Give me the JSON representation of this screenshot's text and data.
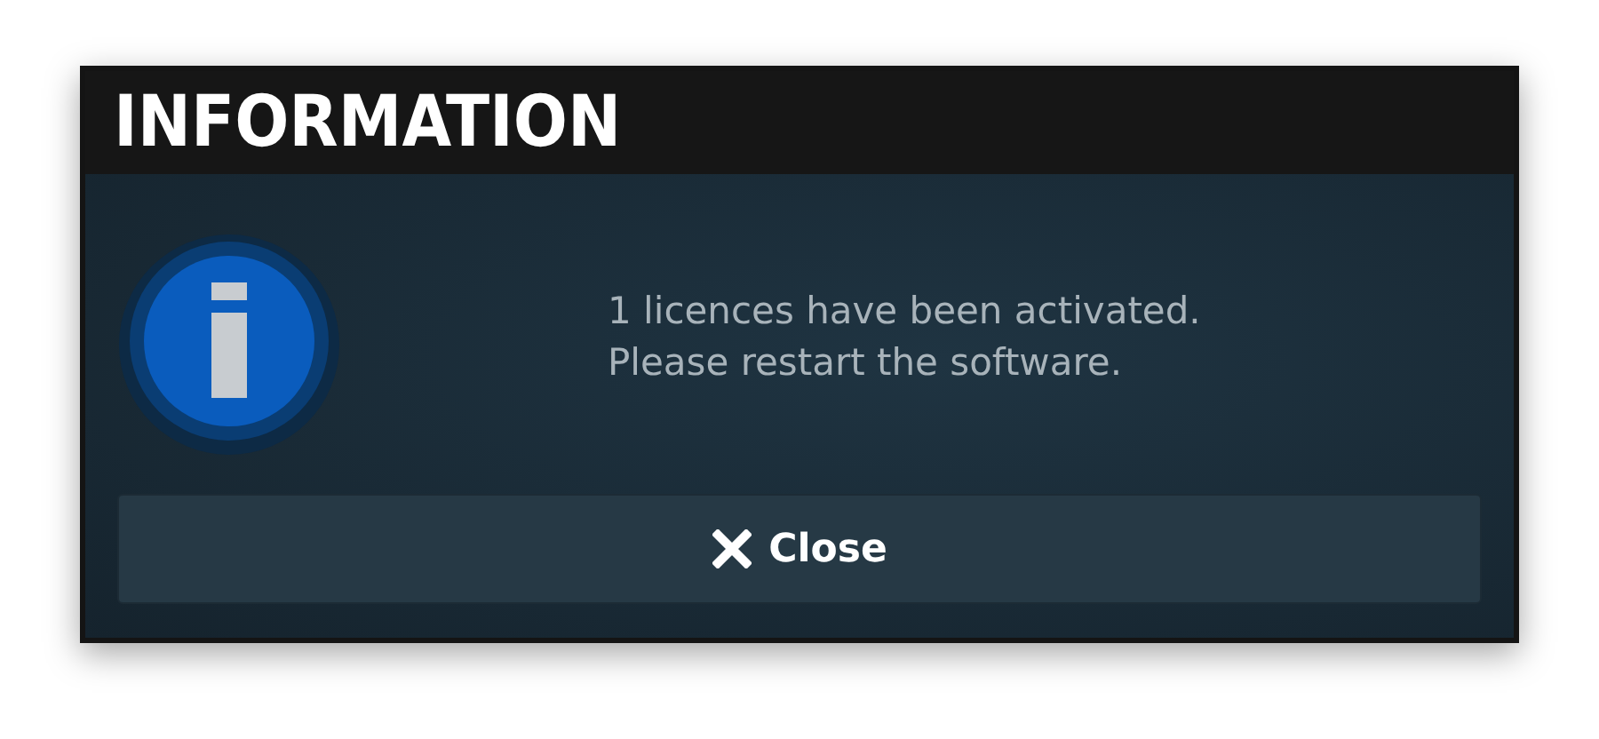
{
  "dialog": {
    "title": "INFORMATION",
    "message_lines": [
      "1 licences have been activated.",
      "Please restart the software."
    ],
    "button": {
      "label": "Close"
    }
  }
}
